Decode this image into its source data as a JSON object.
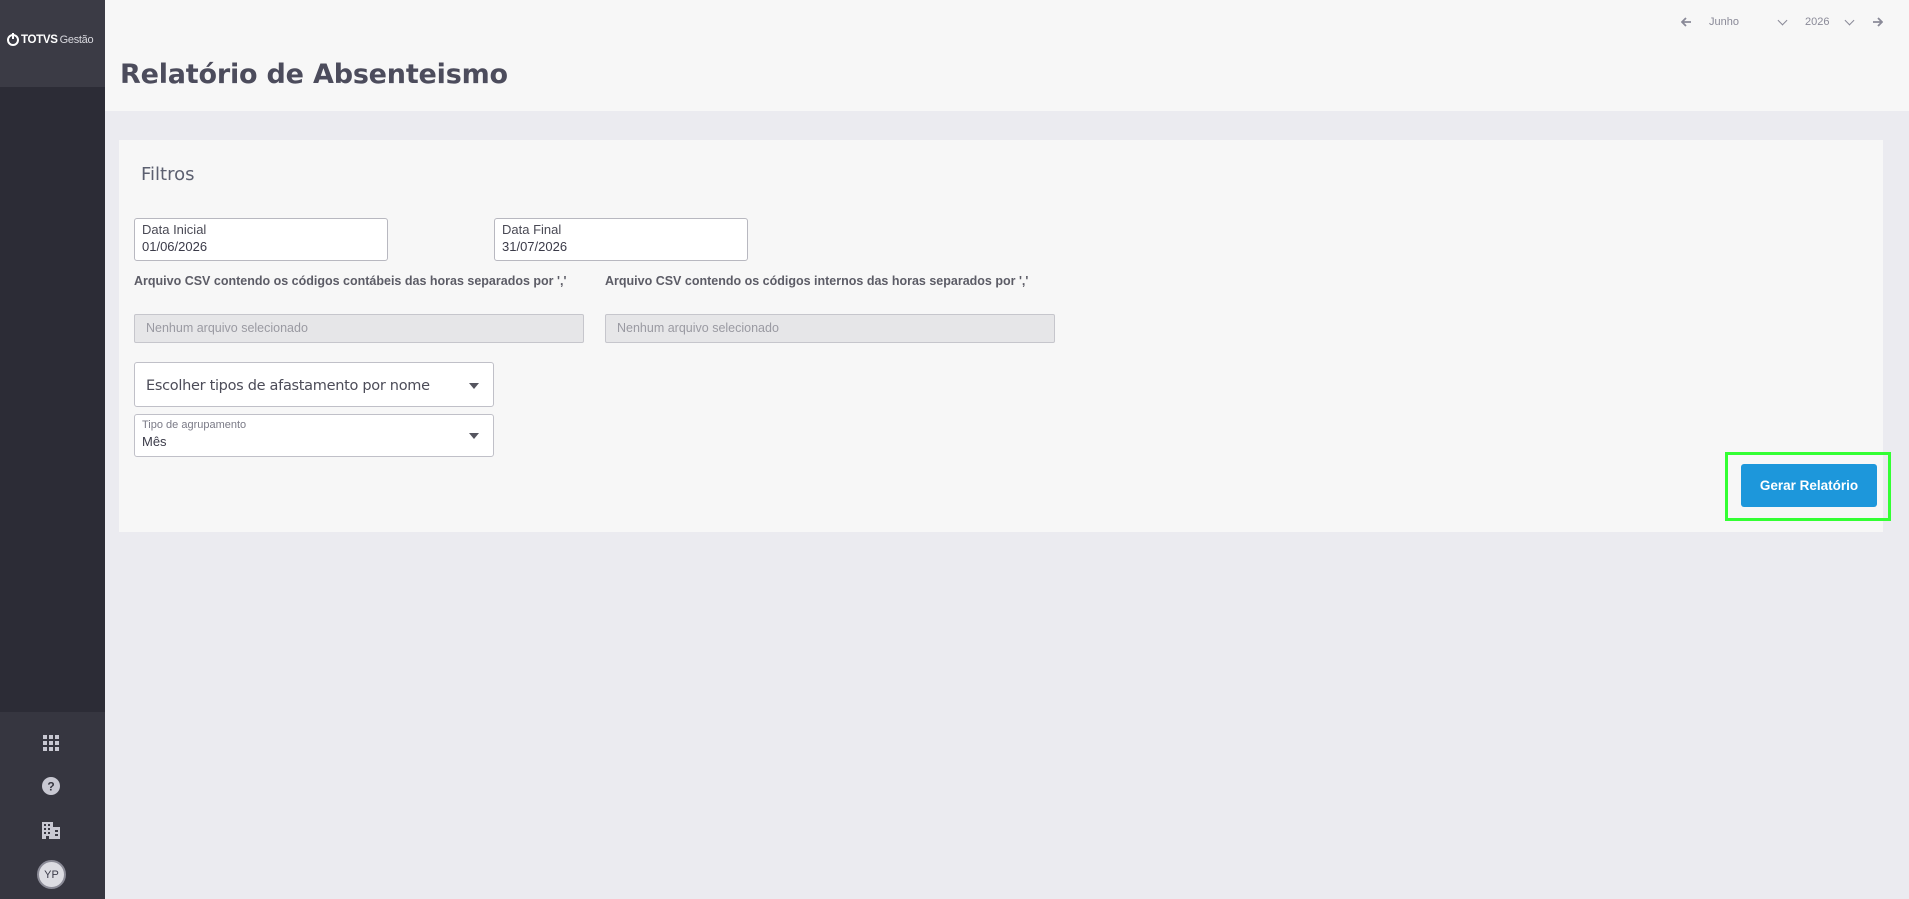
{
  "app": {
    "brand": "TOTVS",
    "product": "Gestão"
  },
  "header": {
    "title": "Relatório de Absenteismo",
    "period": {
      "month": "Junho",
      "year": "2026"
    }
  },
  "sidebar": {
    "avatar_initials": "YP"
  },
  "filters": {
    "title": "Filtros",
    "start_date": {
      "label": "Data Inicial",
      "value": "01/06/2026"
    },
    "end_date": {
      "label": "Data Final",
      "value": "31/07/2026"
    },
    "csv_accounting": {
      "label": "Arquivo CSV contendo os códigos contábeis das horas separados por ','",
      "placeholder": "Nenhum arquivo selecionado"
    },
    "csv_internal": {
      "label": "Arquivo CSV contendo os códigos internos das horas separados por ','",
      "placeholder": "Nenhum arquivo selecionado"
    },
    "leave_types": {
      "placeholder": "Escolher tipos de afastamento por nome"
    },
    "grouping": {
      "label": "Tipo de agrupamento",
      "value": "Mês"
    },
    "generate_label": "Gerar Relatório"
  },
  "colors": {
    "accent": "#1d97db",
    "sidebar": "#2c2c36",
    "highlight": "#33ff33"
  }
}
